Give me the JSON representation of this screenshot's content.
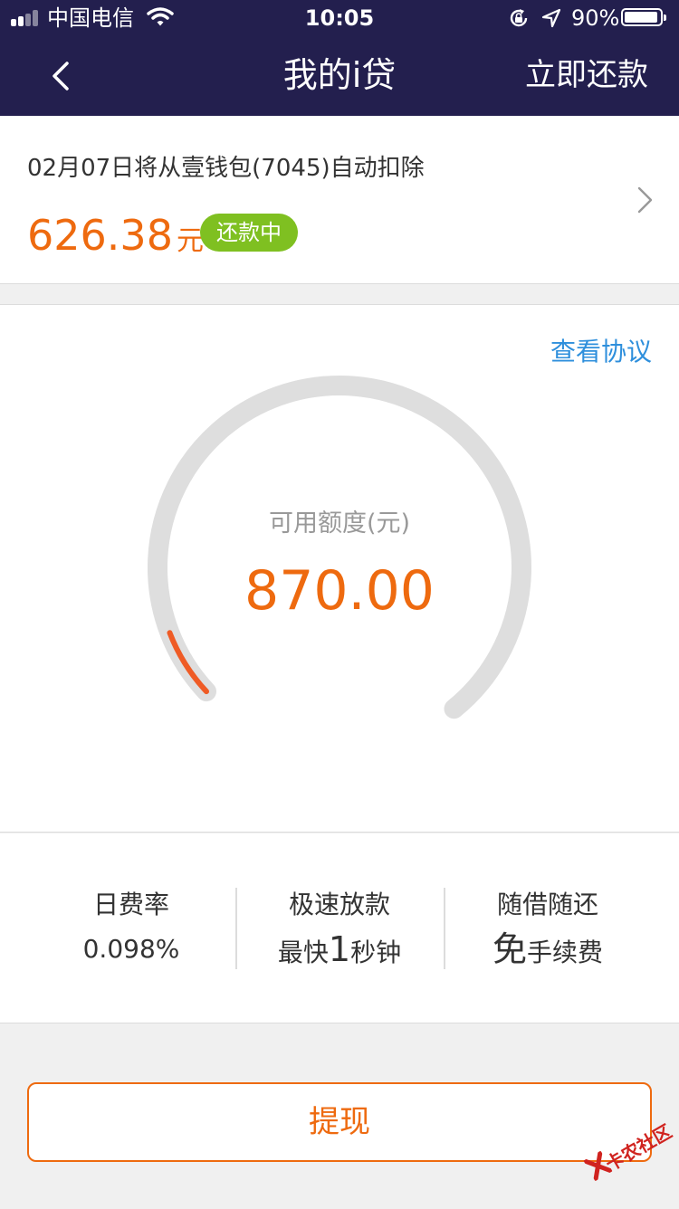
{
  "status_bar": {
    "carrier": "中国电信",
    "time": "10:05",
    "battery_percent": "90%",
    "battery_level": 0.9,
    "icons": [
      "signal-icon",
      "wifi-icon",
      "rotation-lock-icon",
      "location-arrow-icon",
      "battery-icon"
    ]
  },
  "nav": {
    "back_icon": "chevron-left-icon",
    "title": "我的i贷",
    "repay_now": "立即还款"
  },
  "repayment": {
    "description": "02月07日将从壹钱包(7045)自动扣除",
    "amount": "626.38",
    "unit": "元",
    "status": "还款中",
    "chevron_icon": "chevron-right-icon"
  },
  "credit": {
    "agreement_link": "查看协议",
    "label": "可用额度(元)",
    "value": "870.00",
    "gauge_progress": 0.08
  },
  "features": [
    {
      "title": "日费率",
      "sub_parts": [
        {
          "text": "0.098%",
          "big": false
        }
      ]
    },
    {
      "title": "极速放款",
      "sub_parts": [
        {
          "text": "最快",
          "big": false
        },
        {
          "text": "1",
          "big": true
        },
        {
          "text": "秒钟",
          "big": false
        }
      ]
    },
    {
      "title": "随借随还",
      "sub_parts": [
        {
          "text": "免",
          "big": true
        },
        {
          "text": "手续费",
          "big": false
        }
      ]
    }
  ],
  "feat0": {
    "sub": "0.098%"
  },
  "feat1": {
    "a": "最快",
    "b": "1",
    "c": "秒钟"
  },
  "feat2": {
    "a": "免",
    "b": "手续费"
  },
  "withdraw_button": "提现",
  "watermark": "卡农社区",
  "colors": {
    "header_bg": "#231f4e",
    "accent_orange": "#ee6a0f",
    "badge_green": "#7fc021",
    "link_blue": "#2e8fdc",
    "gauge_track": "#dedede",
    "gauge_fill": "#ef5b25"
  }
}
